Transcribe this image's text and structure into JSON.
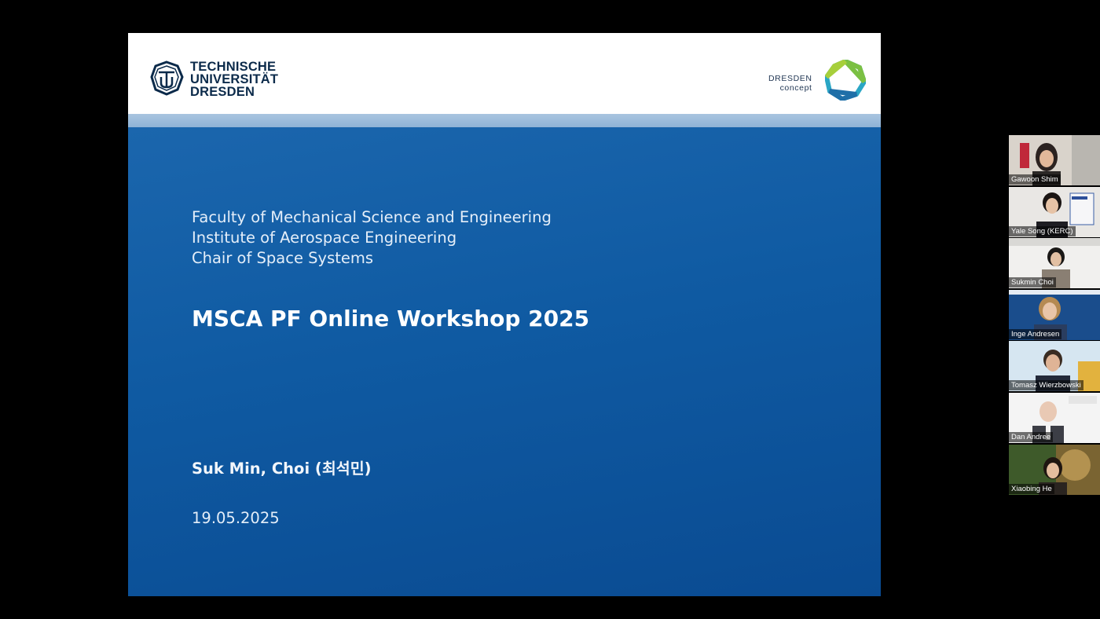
{
  "slide": {
    "university_logo": {
      "lines": [
        "TECHNISCHE",
        "UNIVERSITÄT",
        "DRESDEN"
      ]
    },
    "partner_logo": {
      "line1": "DRESDEN",
      "line2": "concept"
    },
    "affiliation": [
      "Faculty of Mechanical Science and Engineering",
      "Institute of Aerospace Engineering",
      "Chair of Space Systems"
    ],
    "title": "MSCA PF Online Workshop 2025",
    "author": "Suk Min, Choi (최석민)",
    "date": "19.05.2025",
    "colors": {
      "slide_blue": "#0f5aa2",
      "header_band": "#9dbbdc",
      "header_white": "#ffffff"
    }
  },
  "participants": [
    {
      "name": "Gawoon Shim"
    },
    {
      "name": "Yale Song (KERC)"
    },
    {
      "name": "Sukmin Choi"
    },
    {
      "name": "Inge Andresen"
    },
    {
      "name": "Tomasz Wierzbowski"
    },
    {
      "name": "Dan Andree"
    },
    {
      "name": "Xiaobing He"
    }
  ]
}
